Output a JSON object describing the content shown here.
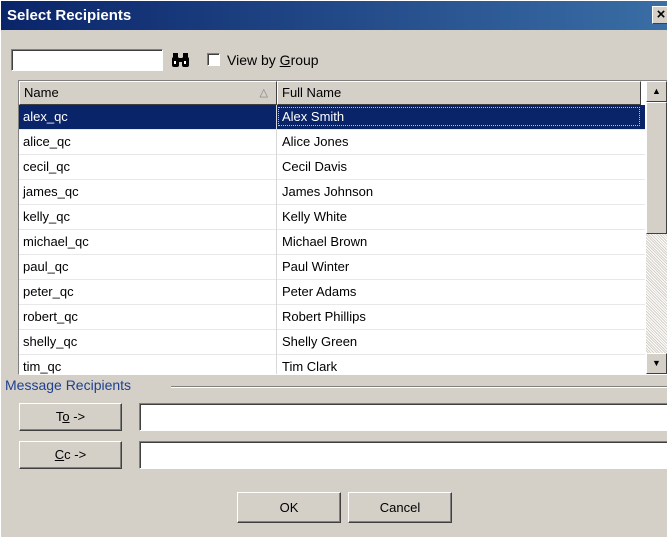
{
  "window": {
    "title": "Select Recipients",
    "close_label": "×"
  },
  "search": {
    "value": "",
    "placeholder": ""
  },
  "view_by_group": {
    "label_pre": "View by ",
    "label_underlined": "G",
    "label_post": "roup",
    "checked": false
  },
  "table": {
    "columns": {
      "name": "Name",
      "full_name": "Full Name",
      "sort_indicator": "△"
    },
    "rows": [
      {
        "name": "alex_qc",
        "full_name": "Alex Smith"
      },
      {
        "name": "alice_qc",
        "full_name": "Alice Jones"
      },
      {
        "name": "cecil_qc",
        "full_name": "Cecil Davis"
      },
      {
        "name": "james_qc",
        "full_name": "James Johnson"
      },
      {
        "name": "kelly_qc",
        "full_name": "Kelly White"
      },
      {
        "name": "michael_qc",
        "full_name": "Michael Brown"
      },
      {
        "name": "paul_qc",
        "full_name": "Paul Winter"
      },
      {
        "name": "peter_qc",
        "full_name": "Peter Adams"
      },
      {
        "name": "robert_qc",
        "full_name": "Robert Phillips"
      },
      {
        "name": "shelly_qc",
        "full_name": "Shelly Green"
      },
      {
        "name": "tim_qc",
        "full_name": "Tim Clark"
      }
    ],
    "selected_row": "alex_qc"
  },
  "recipients": {
    "group_label": "Message Recipients",
    "to_pre": "T",
    "to_u": "o",
    "to_post": " ->",
    "cc_pre": "",
    "cc_u": "C",
    "cc_post": "c ->",
    "to_value": "",
    "cc_value": ""
  },
  "footer": {
    "ok_label": "OK",
    "cancel_label": "Cancel"
  }
}
